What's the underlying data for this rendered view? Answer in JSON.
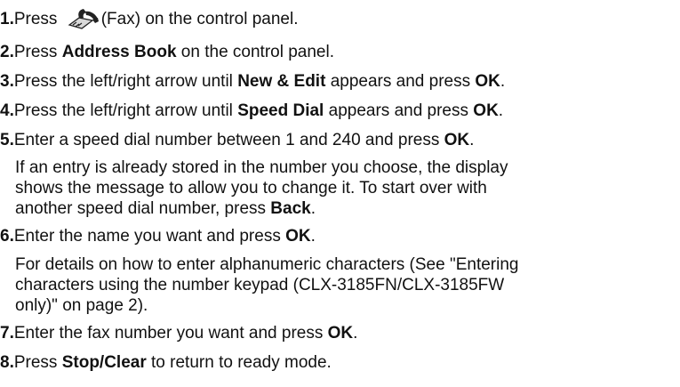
{
  "steps": [
    {
      "num": "1.",
      "pre": "Press ",
      "icon": "fax-icon",
      "post": "(Fax) on the control panel."
    },
    {
      "num": "2.",
      "pre": "Press ",
      "bold": "Address Book",
      "post": " on the control panel."
    },
    {
      "num": "3.",
      "pre": "Press the left/right arrow until ",
      "bold": "New & Edit",
      "mid": " appears and press ",
      "bold2": "OK",
      "post": "."
    },
    {
      "num": "4.",
      "pre": "Press the left/right arrow until ",
      "bold": "Speed Dial",
      "mid": " appears and press ",
      "bold2": "OK",
      "post": "."
    },
    {
      "num": "5.",
      "pre": "Enter a speed dial number between 1 and 240 and press ",
      "bold": "OK",
      "post": "."
    },
    {
      "num": "6.",
      "pre": "Enter the name you want and press ",
      "bold": "OK",
      "post": "."
    },
    {
      "num": "7.",
      "pre": "Enter the fax number you want and press ",
      "bold": "OK",
      "post": "."
    },
    {
      "num": "8.",
      "pre": "Press ",
      "bold": "Stop/Clear",
      "post": " to return to ready mode."
    }
  ],
  "note5": {
    "line1": "If an entry is already stored in the number you choose, the display",
    "line2": "shows the message to allow you to change it. To start over with",
    "line3_pre": "another speed dial number, press ",
    "line3_bold": "Back",
    "line3_post": "."
  },
  "note6": {
    "line1": "For details on how to enter alphanumeric characters (See \"Entering",
    "line2": "characters using the number keypad (CLX-3185FN/CLX-3185FW",
    "line3": "only)\" on page 2)."
  }
}
